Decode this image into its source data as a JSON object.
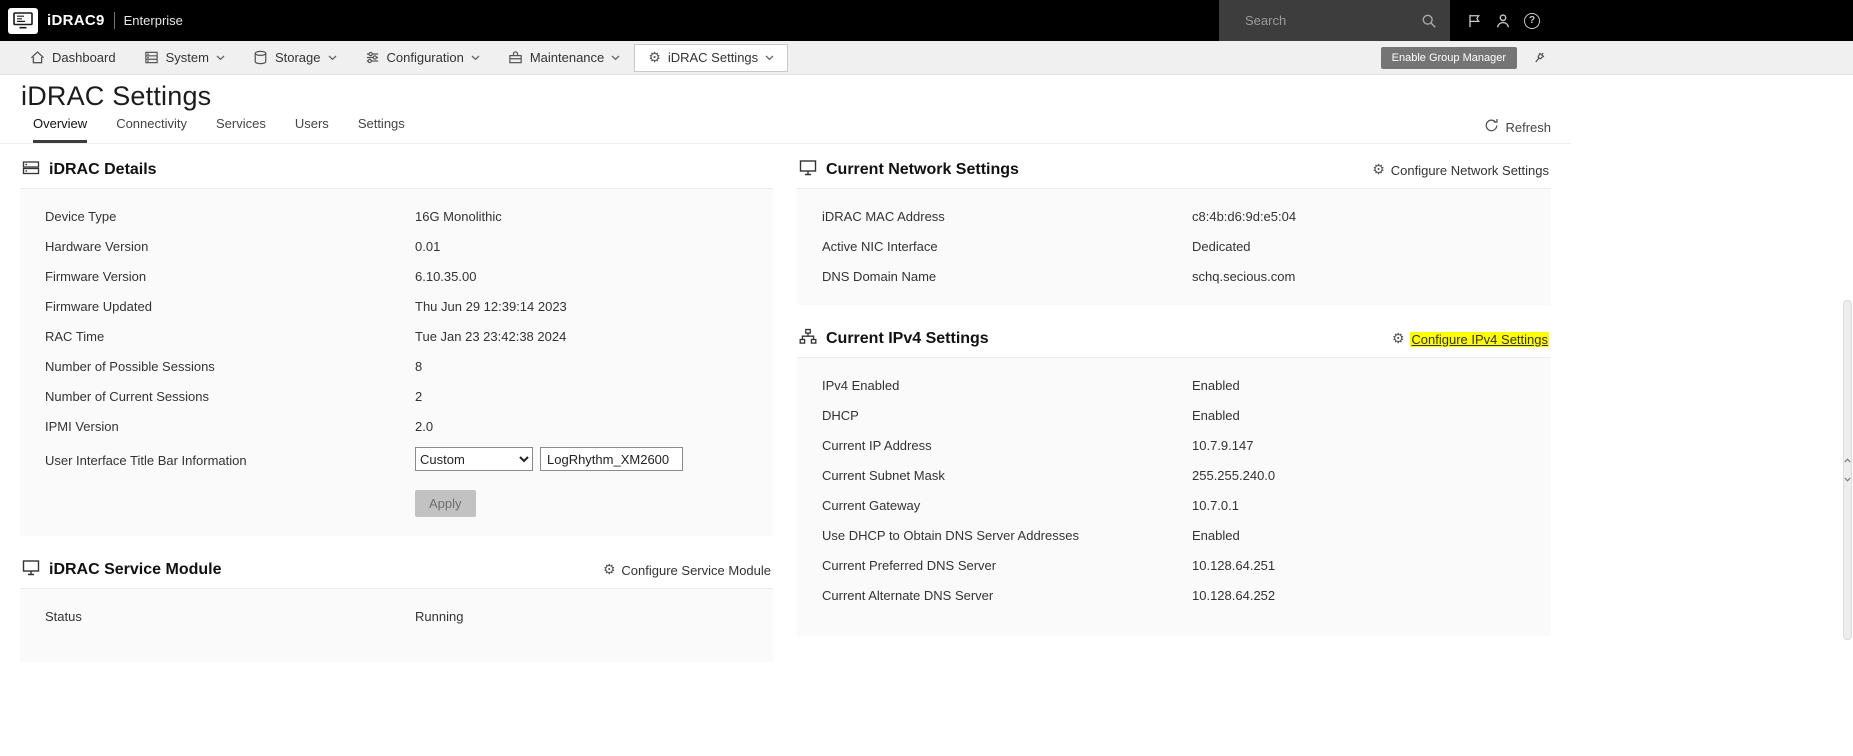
{
  "colors": {
    "highlight": "#ffff00",
    "topbar_bg": "#000000",
    "nav_bg": "#f0f0f0"
  },
  "icons": {
    "gear": "⚙",
    "help": "?"
  },
  "header": {
    "brand": "iDRAC9",
    "edition": "Enterprise",
    "search_placeholder": "Search"
  },
  "nav": {
    "items": [
      {
        "label": "Dashboard"
      },
      {
        "label": "System"
      },
      {
        "label": "Storage"
      },
      {
        "label": "Configuration"
      },
      {
        "label": "Maintenance"
      },
      {
        "label": "iDRAC Settings"
      }
    ],
    "active_item": "iDRAC Settings",
    "group_manager_button": "Enable Group Manager"
  },
  "page": {
    "title": "iDRAC Settings",
    "tabs": [
      "Overview",
      "Connectivity",
      "Services",
      "Users",
      "Settings"
    ],
    "active_tab": "Overview",
    "refresh_label": "Refresh"
  },
  "idrac_details": {
    "title": "iDRAC Details",
    "rows": [
      {
        "label": "Device Type",
        "value": "16G Monolithic"
      },
      {
        "label": "Hardware Version",
        "value": "0.01"
      },
      {
        "label": "Firmware Version",
        "value": "6.10.35.00"
      },
      {
        "label": "Firmware Updated",
        "value": "Thu Jun 29 12:39:14 2023"
      },
      {
        "label": "RAC Time",
        "value": "Tue Jan 23 23:42:38 2024"
      },
      {
        "label": "Number of Possible Sessions",
        "value": "8"
      },
      {
        "label": "Number of Current Sessions",
        "value": "2"
      },
      {
        "label": "IPMI Version",
        "value": "2.0"
      }
    ],
    "title_bar_row": {
      "label": "User Interface Title Bar Information",
      "select_value": "Custom",
      "input_value": "LogRhythm_XM2600"
    },
    "apply_button": "Apply"
  },
  "service_module": {
    "title": "iDRAC Service Module",
    "configure_link": "Configure Service Module",
    "rows": [
      {
        "label": "Status",
        "value": "Running"
      }
    ]
  },
  "network_settings": {
    "title": "Current Network Settings",
    "configure_link": "Configure Network Settings",
    "rows": [
      {
        "label": "iDRAC MAC Address",
        "value": "c8:4b:d6:9d:e5:04"
      },
      {
        "label": "Active NIC Interface",
        "value": "Dedicated"
      },
      {
        "label": "DNS Domain Name",
        "value": "schq.secious.com"
      }
    ]
  },
  "ipv4_settings": {
    "title": "Current IPv4 Settings",
    "configure_link": "Configure IPv4 Settings",
    "configure_highlighted": true,
    "rows": [
      {
        "label": "IPv4 Enabled",
        "value": "Enabled"
      },
      {
        "label": "DHCP",
        "value": "Enabled"
      },
      {
        "label": "Current IP Address",
        "value": "10.7.9.147"
      },
      {
        "label": "Current Subnet Mask",
        "value": "255.255.240.0"
      },
      {
        "label": "Current Gateway",
        "value": "10.7.0.1"
      },
      {
        "label": "Use DHCP to Obtain DNS Server Addresses",
        "value": "Enabled"
      },
      {
        "label": "Current Preferred DNS Server",
        "value": "10.128.64.251"
      },
      {
        "label": "Current Alternate DNS Server",
        "value": "10.128.64.252"
      }
    ]
  }
}
